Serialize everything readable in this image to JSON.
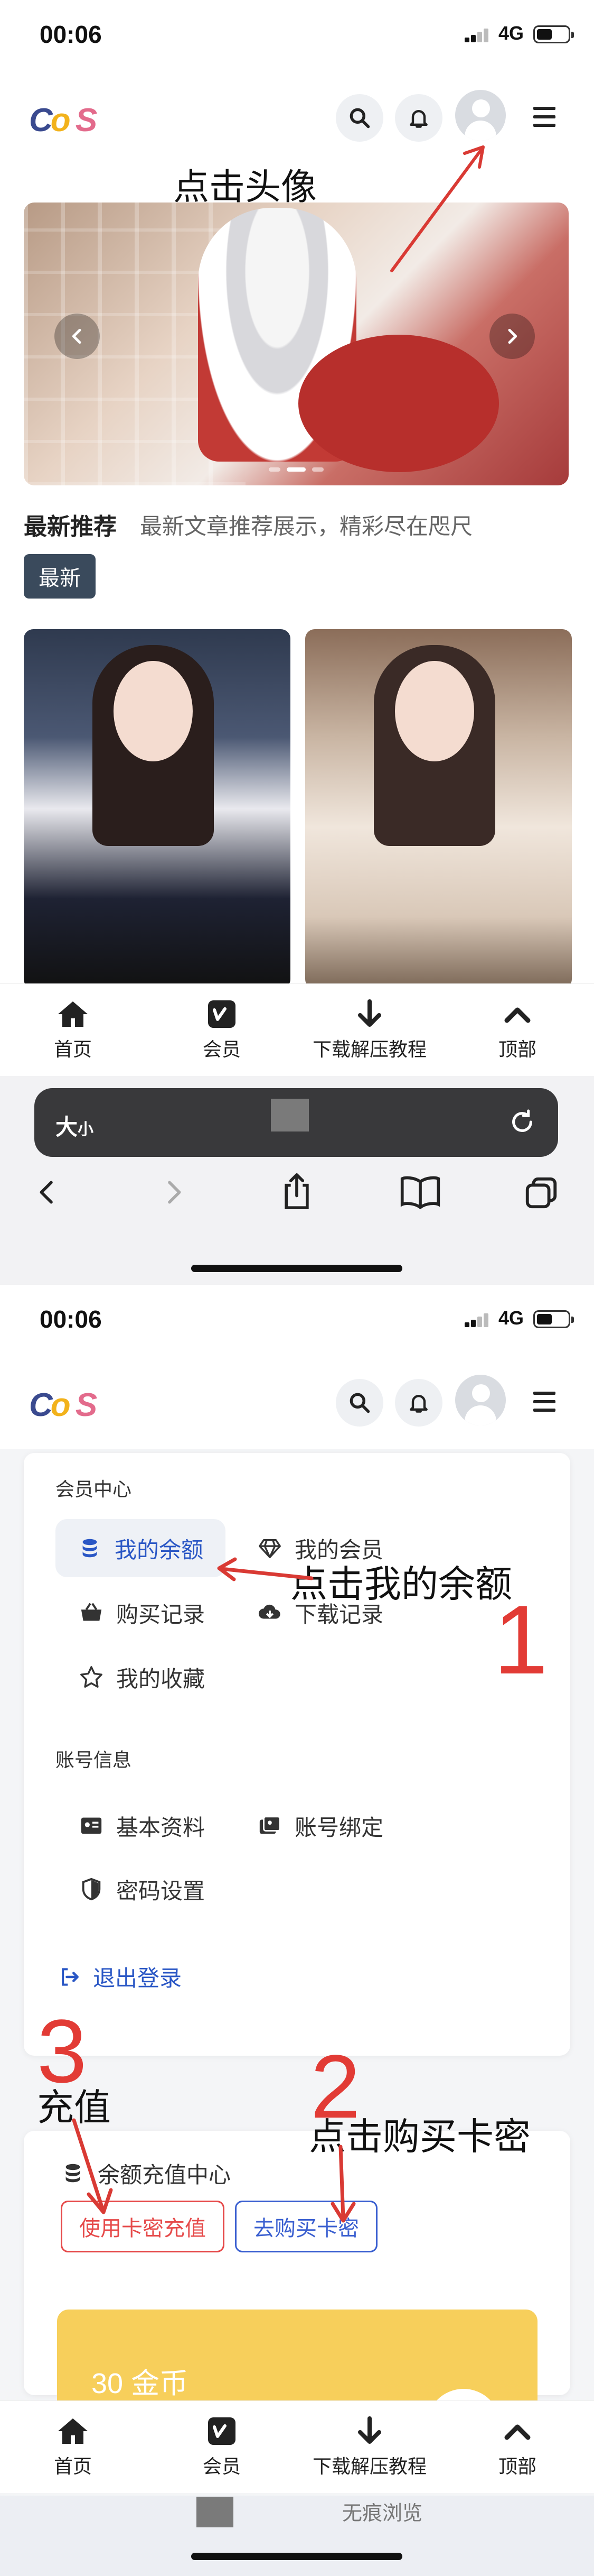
{
  "status": {
    "time": "00:06",
    "network": "4G"
  },
  "logo": {
    "c": "C",
    "o": "o",
    "s": "S"
  },
  "banner": {},
  "section": {
    "title": "最新推荐",
    "desc": "最新文章推荐展示，精彩尽在咫尺",
    "tag": "最新"
  },
  "tabbar": {
    "home": "首页",
    "member": "会员",
    "download": "下载解压教程",
    "top": "顶部"
  },
  "safari": {
    "aa_big": "大",
    "aa_small": "小"
  },
  "member": {
    "center_title": "会员中心",
    "balance": "我的余额",
    "vip": "我的会员",
    "purchase": "购买记录",
    "downloads": "下载记录",
    "favorites": "我的收藏",
    "account_title": "账号信息",
    "profile": "基本资料",
    "binding": "账号绑定",
    "password": "密码设置",
    "logout": "退出登录"
  },
  "recharge": {
    "title": "余额充值中心",
    "card_recharge": "使用卡密充值",
    "buy_card": "去购买卡密",
    "coins": "30 金币"
  },
  "bottom": {
    "private": "无痕浏览"
  },
  "annotations": {
    "click_avatar": "点击头像",
    "click_balance": "点击我的余额",
    "step1": "1",
    "step2": "2",
    "step3": "3",
    "recharge": "充值",
    "buy_card": "点击购买卡密"
  },
  "colors": {
    "accent": "#2a57c5",
    "red": "#e64a4a",
    "gold": "#f7cf5b",
    "annotation": "#e23b35"
  }
}
